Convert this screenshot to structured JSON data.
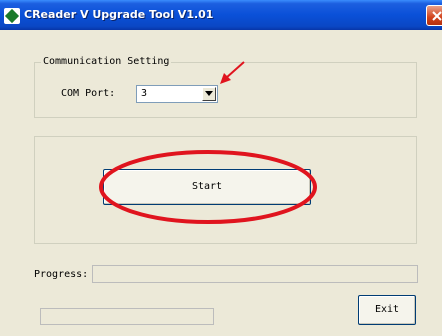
{
  "window": {
    "title": "CReader V Upgrade Tool V1.01",
    "icons": {
      "app": "app-icon",
      "close": "close-icon"
    }
  },
  "communication": {
    "group_title": "Communication Setting",
    "com_port_label": "COM Port:",
    "com_port_value": "3"
  },
  "actions": {
    "start_label": "Start",
    "exit_label": "Exit"
  },
  "progress": {
    "label": "Progress:",
    "main_value": 0,
    "secondary_value": 0
  },
  "annotations": {
    "color": "#e0141e"
  }
}
